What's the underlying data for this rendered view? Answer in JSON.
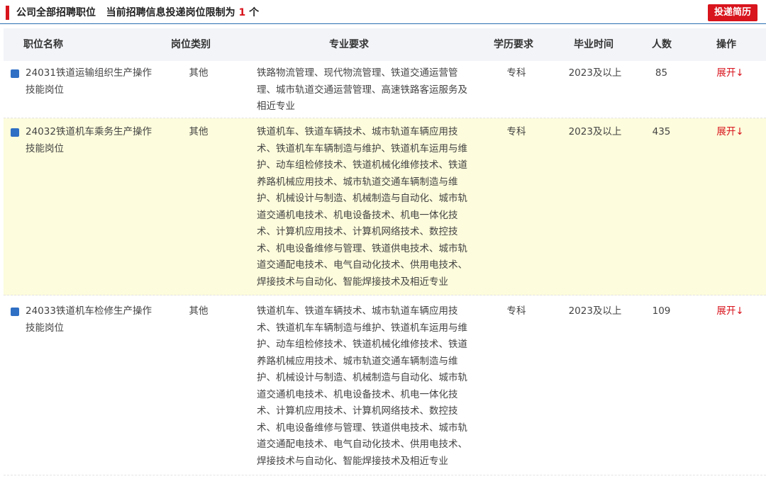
{
  "header": {
    "title_prefix": "公司全部招聘职位   当前招聘信息投递岗位限制为 ",
    "limit_count": "1",
    "title_suffix": " 个",
    "submit_button": "投递简历"
  },
  "table": {
    "columns": [
      "职位名称",
      "岗位类别",
      "专业要求",
      "学历要求",
      "毕业时间",
      "人数",
      "操作"
    ],
    "rows": [
      {
        "name": "24031铁道运输组织生产操作技能岗位",
        "category": "其他",
        "major": "铁路物流管理、现代物流管理、铁道交通运营管理、城市轨道交通运营管理、高速铁路客运服务及相近专业",
        "education": "专科",
        "graduation": "2023及以上",
        "count": "85",
        "action": "展开↓"
      },
      {
        "name": "24032铁道机车乘务生产操作技能岗位",
        "category": "其他",
        "major": "铁道机车、铁道车辆技术、城市轨道车辆应用技术、铁道机车车辆制造与维护、铁道机车运用与维护、动车组检修技术、铁道机械化维修技术、铁道养路机械应用技术、城市轨道交通车辆制造与维护、机械设计与制造、机械制造与自动化、城市轨道交通机电技术、机电设备技术、机电一体化技术、计算机应用技术、计算机网络技术、数控技术、机电设备维修与管理、铁道供电技术、城市轨道交通配电技术、电气自动化技术、供用电技术、焊接技术与自动化、智能焊接技术及相近专业",
        "education": "专科",
        "graduation": "2023及以上",
        "count": "435",
        "action": "展开↓"
      },
      {
        "name": "24033铁道机车检修生产操作技能岗位",
        "category": "其他",
        "major": "铁道机车、铁道车辆技术、城市轨道车辆应用技术、铁道机车车辆制造与维护、铁道机车运用与维护、动车组检修技术、铁道机械化维修技术、铁道养路机械应用技术、城市轨道交通车辆制造与维护、机械设计与制造、机械制造与自动化、城市轨道交通机电技术、机电设备技术、机电一体化技术、计算机应用技术、计算机网络技术、数控技术、机电设备维修与管理、铁道供电技术、城市轨道交通配电技术、电气自动化技术、供用电技术、焊接技术与自动化、智能焊接技术及相近专业",
        "education": "专科",
        "graduation": "2023及以上",
        "count": "109",
        "action": "展开↓"
      }
    ]
  },
  "colors": {
    "accent_red": "#d8141c",
    "header_line": "#2a6fb0",
    "row_highlight": "#fdfcdc",
    "square_blue": "#2f6fc4"
  }
}
